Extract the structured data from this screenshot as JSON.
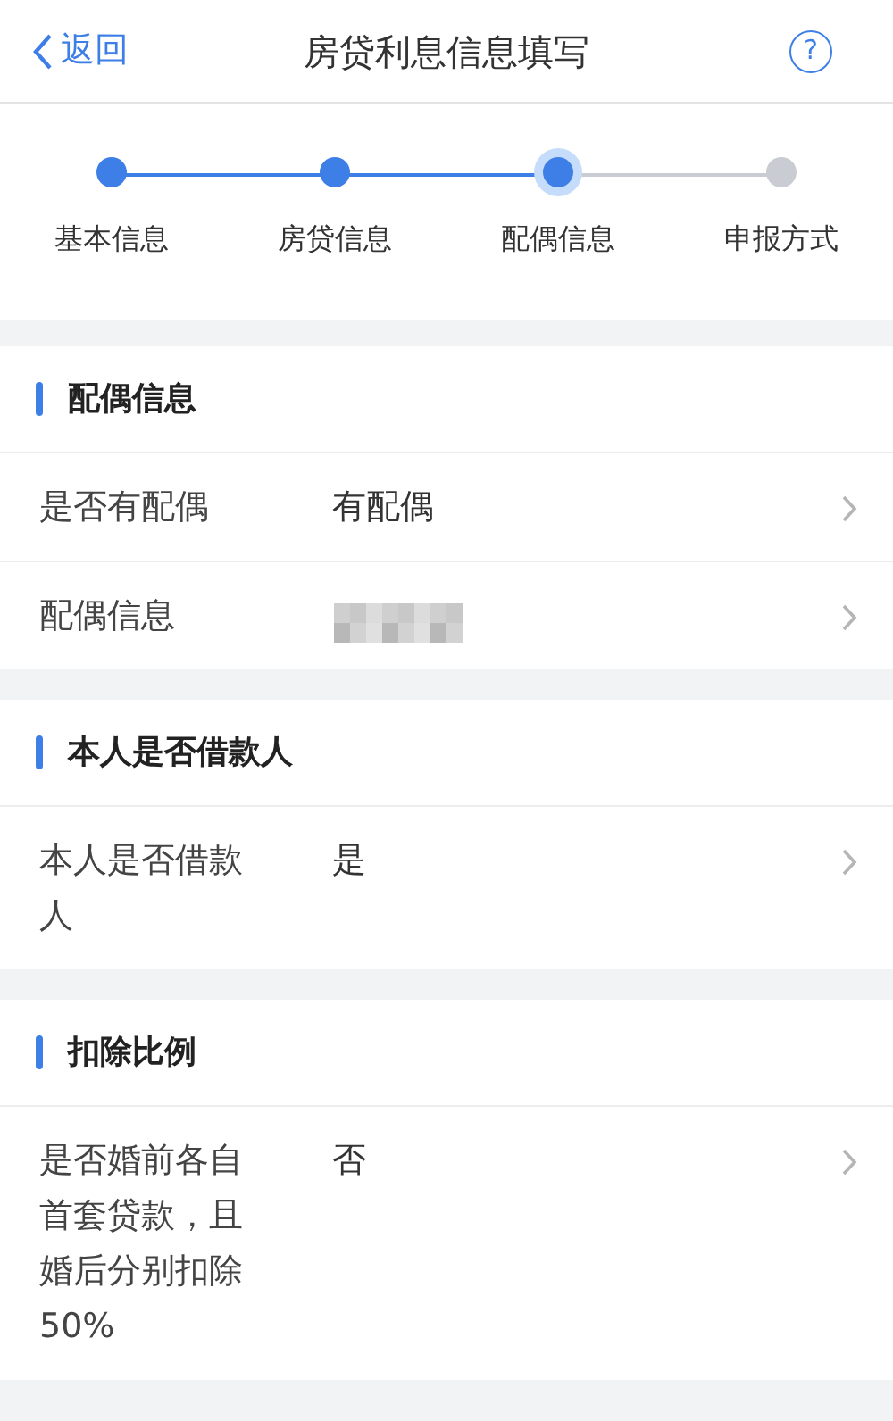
{
  "header": {
    "back": "返回",
    "title": "房贷利息信息填写",
    "help_icon": "?"
  },
  "steps": [
    {
      "label": "基本信息",
      "done": true,
      "selected": false
    },
    {
      "label": "房贷信息",
      "done": true,
      "selected": false
    },
    {
      "label": "配偶信息",
      "done": false,
      "selected": true
    },
    {
      "label": "申报方式",
      "done": false,
      "selected": false
    }
  ],
  "sections": [
    {
      "title": "配偶信息",
      "rows": [
        {
          "kind": "text",
          "label": "是否有配偶",
          "value": "有配偶"
        },
        {
          "kind": "redacted",
          "label": "配偶信息"
        }
      ]
    },
    {
      "title": "本人是否借款人",
      "rows": [
        {
          "kind": "text",
          "label": "本人是否借款人",
          "value": "是"
        }
      ]
    },
    {
      "title": "扣除比例",
      "rows": [
        {
          "kind": "text",
          "label": "是否婚前各自首套贷款，且婚后分别扣除50%",
          "value": "否"
        }
      ]
    }
  ]
}
